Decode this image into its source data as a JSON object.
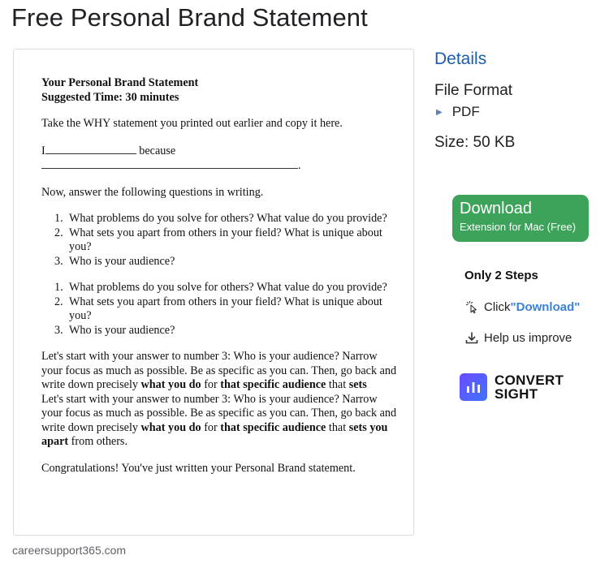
{
  "page": {
    "title": "Free Personal Brand Statement"
  },
  "document": {
    "heading1": "Your Personal Brand Statement",
    "heading2": "Suggested Time: 30 minutes",
    "intro": "Take the WHY statement you printed out earlier and copy it here.",
    "fill_prefix": "I",
    "fill_because": "because",
    "fill_end": ".",
    "questions_intro": "Now, answer the following questions in writing.",
    "questions_a": [
      {
        "num": "1.",
        "text": "What problems do you solve for others? What value do you provide?"
      },
      {
        "num": "2.",
        "text": "What sets you apart from others in your field? What is unique about you?"
      },
      {
        "num": "3.",
        "text": "Who is your audience?"
      }
    ],
    "questions_b": [
      {
        "num": "1.",
        "text": "What problems do you solve for others? What value do you provide?"
      },
      {
        "num": "2.",
        "text": "What sets you apart from others in your field? What is unique about you?"
      },
      {
        "num": "3.",
        "text": "Who is your audience?"
      }
    ],
    "para1": {
      "lead": "Let's start with your answer to number 3: Who is your audience? Narrow your focus as much as possible. Be as specific as you can. Then, go back and write down precisely ",
      "b1": "what you do",
      "mid1": " for ",
      "b2": "that specific audience",
      "mid2": " that ",
      "b3": "sets"
    },
    "para2": {
      "lead": "Let's start with your answer to number 3: Who is your audience? Narrow your focus as much as possible. Be as specific as you can. Then, go back and write down precisely ",
      "b1": "what you do",
      "mid1": " for ",
      "b2": "that specific audience",
      "mid2": " that ",
      "b3": "sets you apart",
      "tail": " from others."
    },
    "closing": "Congratulations! You've just written your Personal Brand statement."
  },
  "source": "careersupport365.com",
  "sidebar": {
    "details_label": "Details",
    "file_format_label": "File Format",
    "file_format_value": "PDF",
    "size_label": "Size: 50 KB",
    "download": {
      "title": "Download",
      "subtitle": "Extension for Mac (Free)"
    },
    "steps_title": "Only 2 Steps",
    "step1_prefix": "Click ",
    "step1_link": "\"Download\"",
    "step2": "Help us improve",
    "brand_line1": "CONVERT",
    "brand_line2": "SIGHT"
  },
  "colors": {
    "accent_green": "#3ea35a",
    "link_blue": "#1a5dab",
    "step_blue": "#3b82d9",
    "logo_purple": "#5b5cff"
  }
}
